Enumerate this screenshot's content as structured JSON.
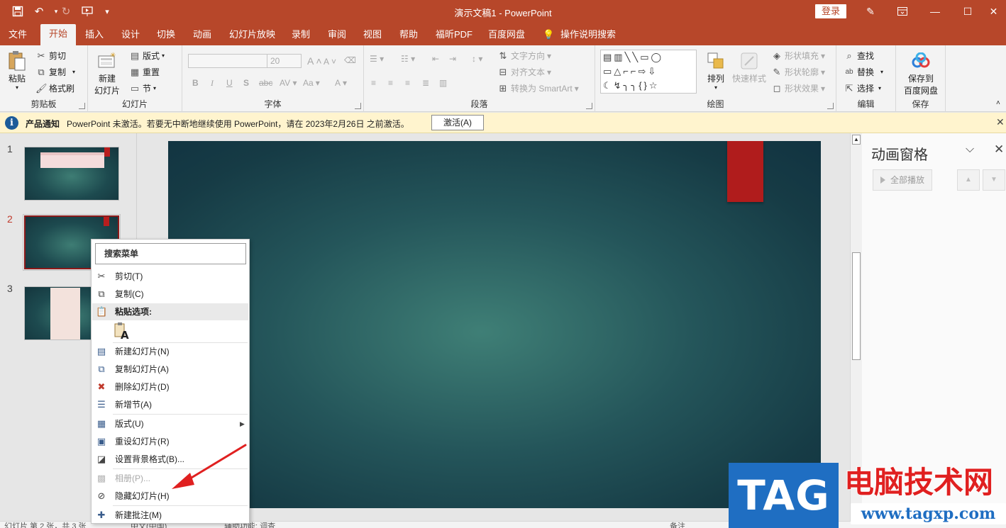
{
  "window": {
    "title": "演示文稿1  -  PowerPoint",
    "login_label": "登录",
    "icons": [
      "save-icon",
      "undo-icon",
      "redo-icon",
      "present-icon",
      "customize-icon",
      "pen-icon",
      "ribbon-display-icon",
      "minimize-icon",
      "maximize-icon",
      "close-icon"
    ]
  },
  "tabs": [
    "文件",
    "开始",
    "插入",
    "设计",
    "切换",
    "动画",
    "幻灯片放映",
    "录制",
    "审阅",
    "视图",
    "帮助",
    "福昕PDF",
    "百度网盘",
    "操作说明搜索"
  ],
  "active_tab": "开始",
  "ribbon": {
    "clipboard": {
      "paste": "粘贴",
      "cut": "剪切",
      "copy": "复制",
      "format_painter": "格式刷",
      "label": "剪贴板"
    },
    "slides": {
      "new_slide_line1": "新建",
      "new_slide_line2": "幻灯片",
      "layout": "版式",
      "reset": "重置",
      "section": "节",
      "label": "幻灯片"
    },
    "font": {
      "size": "20",
      "bold": "B",
      "italic": "I",
      "underline": "U",
      "strike": "S",
      "case": "Aa",
      "color": "A",
      "grow": "A",
      "shrink": "A",
      "label": "字体"
    },
    "paragraph": {
      "text_direction": "文字方向",
      "align_text": "对齐文本",
      "smartart": "转换为 SmartArt",
      "label": "段落"
    },
    "drawing": {
      "arrange": "排列",
      "quick_styles": "快速样式",
      "fill": "形状填充",
      "outline": "形状轮廓",
      "effects": "形状效果",
      "label": "绘图"
    },
    "editing": {
      "find": "查找",
      "replace": "替换",
      "select": "选择",
      "label": "编辑"
    },
    "save": {
      "line1": "保存到",
      "line2": "百度网盘",
      "label": "保存"
    }
  },
  "notification": {
    "icon": "info-icon",
    "title": "产品通知",
    "message": "PowerPoint 未激活。若要无中断地继续使用 PowerPoint，请在 2023年2月26日 之前激活。",
    "button": "激活(A)"
  },
  "thumbnails": [
    {
      "number": "1"
    },
    {
      "number": "2",
      "selected": true
    },
    {
      "number": "3"
    }
  ],
  "animation_pane": {
    "title": "动画窗格",
    "play_all": "全部播放",
    "up": "▲",
    "down": "▼"
  },
  "context_menu": {
    "search": "搜索菜单",
    "cut": "剪切(T)",
    "copy": "复制(C)",
    "paste_options": "粘贴选项:",
    "new_slide": "新建幻灯片(N)",
    "duplicate_slide": "复制幻灯片(A)",
    "delete_slide": "删除幻灯片(D)",
    "add_section": "新增节(A)",
    "layout": "版式(U)",
    "reset_slide": "重设幻灯片(R)",
    "format_background": "设置背景格式(B)...",
    "photo_album": "相册(P)...",
    "hide_slide": "隐藏幻灯片(H)",
    "new_comment": "新建批注(M)"
  },
  "statusbar": {
    "slide_info": "幻灯片 第 2 张，共 3 张",
    "language": "中文(中国)",
    "accessibility": "辅助功能: 调查",
    "notes": "备注"
  },
  "watermark": {
    "tag": "TAG",
    "site_name": "电脑技术网",
    "url": "www.tagxp.com"
  },
  "colors": {
    "accent": "#b7472a",
    "slide_tag": "#b01c1c",
    "annotation_arrow": "#e02020",
    "notify_bg": "#fff4ce"
  }
}
